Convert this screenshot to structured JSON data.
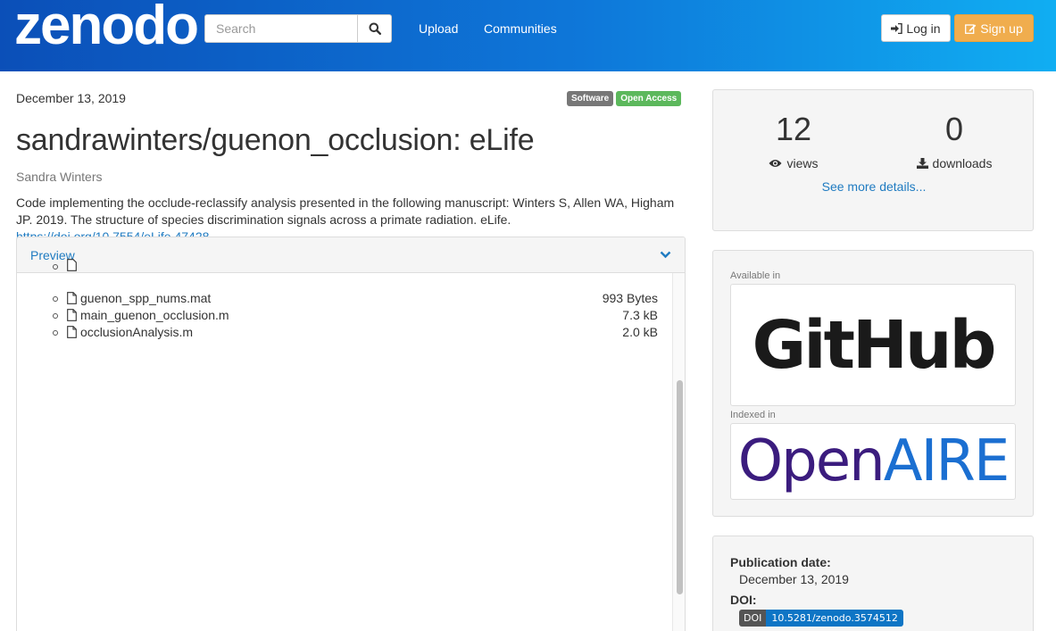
{
  "header": {
    "logo": "zenodo",
    "search": {
      "placeholder": "Search",
      "value": "",
      "button_icon": "search-icon"
    },
    "nav": {
      "upload": "Upload",
      "communities": "Communities"
    },
    "login_label": "Log in",
    "signup_label": "Sign up"
  },
  "record": {
    "date": "December 13, 2019",
    "badges": {
      "type": "Software",
      "access": "Open Access"
    },
    "title": "sandrawinters/guenon_occlusion: eLife",
    "author": "Sandra Winters",
    "description": "Code implementing the occlude-reclassify analysis presented in the following manuscript: Winters S, Allen WA, Higham JP. 2019. The structure of species discrimination signals across a primate radiation. eLife.",
    "doi_link": "https://doi.org/10.7554/eLife.47428"
  },
  "preview": {
    "heading": "Preview",
    "files": [
      {
        "name": "guenon_spp_nums.mat",
        "size": "993 Bytes"
      },
      {
        "name": "main_guenon_occlusion.m",
        "size": "7.3 kB"
      },
      {
        "name": "occlusionAnalysis.m",
        "size": "2.0 kB"
      }
    ]
  },
  "stats": {
    "views": {
      "count": "12",
      "label": "views"
    },
    "downloads": {
      "count": "0",
      "label": "downloads"
    },
    "see_more": "See more details..."
  },
  "availability": {
    "available_label": "Available in",
    "github_logo": "GitHub",
    "indexed_label": "Indexed in",
    "openaire_logo_open": "Open",
    "openaire_logo_aire": "AIRE"
  },
  "info": {
    "publication_date_label": "Publication date:",
    "publication_date": "December 13, 2019",
    "doi_label": "DOI:",
    "doi_prefix": "DOI",
    "doi_value": "10.5281/zenodo.3574512"
  },
  "colors": {
    "header_gradient_start": "#0b4fb8",
    "header_gradient_end": "#10aef2",
    "link": "#1f7bc1",
    "signup": "#f0ad4e",
    "open_access": "#5cb85c"
  }
}
